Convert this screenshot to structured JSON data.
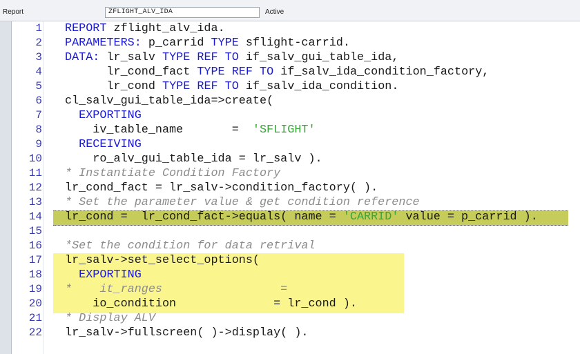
{
  "header": {
    "object_type_label": "Report",
    "object_name": "ZFLIGHT_ALV_IDA",
    "status": "Active"
  },
  "editor": {
    "lines": [
      {
        "num": "1",
        "tokens": [
          {
            "t": "REPORT",
            "c": "kw"
          },
          {
            "t": " zflight_alv_ida.",
            "c": "tx"
          }
        ]
      },
      {
        "num": "2",
        "tokens": [
          {
            "t": "PARAMETERS:",
            "c": "kw"
          },
          {
            "t": " p_carrid ",
            "c": "tx"
          },
          {
            "t": "TYPE",
            "c": "kw"
          },
          {
            "t": " sflight-carrid.",
            "c": "tx"
          }
        ]
      },
      {
        "num": "3",
        "tokens": [
          {
            "t": "DATA:",
            "c": "kw"
          },
          {
            "t": " lr_salv ",
            "c": "tx"
          },
          {
            "t": "TYPE",
            "c": "kw"
          },
          {
            "t": " ",
            "c": "tx"
          },
          {
            "t": "REF",
            "c": "kw"
          },
          {
            "t": " ",
            "c": "tx"
          },
          {
            "t": "TO",
            "c": "kw"
          },
          {
            "t": " if_salv_gui_table_ida,",
            "c": "tx"
          }
        ]
      },
      {
        "num": "4",
        "tokens": [
          {
            "t": "      lr_cond_fact ",
            "c": "tx"
          },
          {
            "t": "TYPE",
            "c": "kw"
          },
          {
            "t": " ",
            "c": "tx"
          },
          {
            "t": "REF",
            "c": "kw"
          },
          {
            "t": " ",
            "c": "tx"
          },
          {
            "t": "TO",
            "c": "kw"
          },
          {
            "t": " if_salv_ida_condition_factory,",
            "c": "tx"
          }
        ]
      },
      {
        "num": "5",
        "tokens": [
          {
            "t": "      lr_cond ",
            "c": "tx"
          },
          {
            "t": "TYPE",
            "c": "kw"
          },
          {
            "t": " ",
            "c": "tx"
          },
          {
            "t": "REF",
            "c": "kw"
          },
          {
            "t": " ",
            "c": "tx"
          },
          {
            "t": "TO",
            "c": "kw"
          },
          {
            "t": " if_salv_ida_condition.",
            "c": "tx"
          }
        ]
      },
      {
        "num": "6",
        "tokens": [
          {
            "t": "cl_salv_gui_table_ida=>create(",
            "c": "tx"
          }
        ]
      },
      {
        "num": "7",
        "tokens": [
          {
            "t": "  ",
            "c": "tx"
          },
          {
            "t": "EXPORTING",
            "c": "kw"
          }
        ]
      },
      {
        "num": "8",
        "tokens": [
          {
            "t": "    iv_table_name       =  ",
            "c": "tx"
          },
          {
            "t": "'SFLIGHT'",
            "c": "str"
          }
        ]
      },
      {
        "num": "9",
        "tokens": [
          {
            "t": "  ",
            "c": "tx"
          },
          {
            "t": "RECEIVING",
            "c": "kw"
          }
        ]
      },
      {
        "num": "10",
        "tokens": [
          {
            "t": "    ro_alv_gui_table_ida = lr_salv ).",
            "c": "tx"
          }
        ]
      },
      {
        "num": "11",
        "tokens": [
          {
            "t": "* Instantiate Condition Factory",
            "c": "cm"
          }
        ]
      },
      {
        "num": "12",
        "tokens": [
          {
            "t": "lr_cond_fact = lr_salv->condition_factory( ).",
            "c": "tx"
          }
        ]
      },
      {
        "num": "13",
        "tokens": [
          {
            "t": "* Set the parameter value & get condition reference",
            "c": "cm"
          }
        ]
      },
      {
        "num": "14",
        "tokens": [
          {
            "t": "lr_cond =  lr_cond_fact->equals( name = ",
            "c": "tx"
          },
          {
            "t": "'CARRID'",
            "c": "str"
          },
          {
            "t": " value = p_carrid ).",
            "c": "tx"
          }
        ]
      },
      {
        "num": "15",
        "tokens": []
      },
      {
        "num": "16",
        "tokens": [
          {
            "t": "*Set the condition for data retrival",
            "c": "cm"
          }
        ]
      },
      {
        "num": "17",
        "tokens": [
          {
            "t": "lr_salv->set_select_options(",
            "c": "tx"
          }
        ]
      },
      {
        "num": "18",
        "tokens": [
          {
            "t": "  ",
            "c": "tx"
          },
          {
            "t": "EXPORTING",
            "c": "kw"
          }
        ]
      },
      {
        "num": "19",
        "tokens": [
          {
            "t": "*    it_ranges                 =",
            "c": "cm"
          }
        ]
      },
      {
        "num": "20",
        "tokens": [
          {
            "t": "    io_condition              = lr_cond ).",
            "c": "tx"
          }
        ]
      },
      {
        "num": "21",
        "tokens": [
          {
            "t": "* Display ALV",
            "c": "cm"
          }
        ]
      },
      {
        "num": "22",
        "tokens": [
          {
            "t": "lr_salv->fullscreen( )->display( ).",
            "c": "tx"
          }
        ]
      }
    ]
  },
  "colors": {
    "keyword": "#1a1ad2",
    "string": "#3aa33a",
    "comment": "#8c8c8c",
    "line_number": "#3a3ab0",
    "highlight_olive": "#c6cc5a",
    "highlight_yellow": "#fbf58e"
  }
}
